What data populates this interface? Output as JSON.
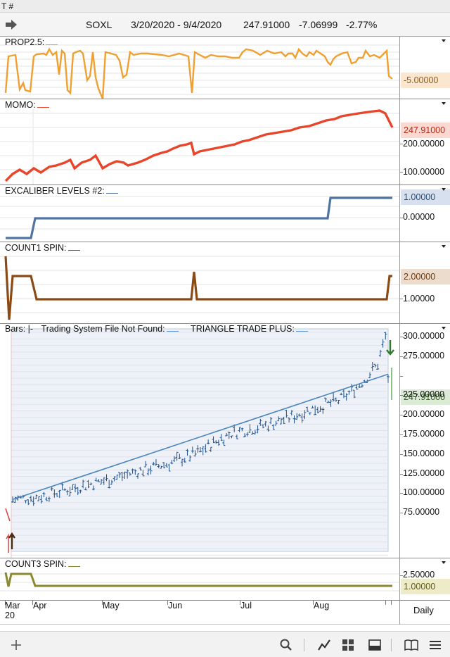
{
  "window": {
    "title_fragment": "T #"
  },
  "header": {
    "symbol": "SOXL",
    "date_range": "3/20/2020 - 9/4/2020",
    "last_price": "247.91000",
    "change": "-7.06999",
    "change_pct": "-2.77%"
  },
  "colors": {
    "prop": "#f0a030",
    "momo": "#e8452a",
    "excaliber": "#4f74a3",
    "count1": "#8b4a14",
    "count3": "#8c8a2e",
    "regression": "#4a86c0",
    "bars": "#1d4f8a"
  },
  "panes": {
    "prop": {
      "title": "PROP2.5:",
      "badge": "-5.00000"
    },
    "momo": {
      "title": "MOMO:",
      "badge": "247.91000",
      "ticks": [
        "200.00000",
        "100.00000"
      ]
    },
    "excaliber": {
      "title": "EXCALIBER LEVELS #2:",
      "badge": "1.00000",
      "ticks": [
        "0.00000"
      ]
    },
    "count1": {
      "title": "COUNT1 SPIN:",
      "badge": "2.00000",
      "ticks": [
        "1.00000"
      ]
    },
    "bars": {
      "title_prefix": "Bars:",
      "title_sep": "|-",
      "system_label": "Trading System File Not Found:",
      "overlay_label": "TRIANGLE TRADE PLUS:",
      "badge": "247.91000",
      "ticks": [
        "300.00000",
        "275.00000",
        "250.00000",
        "225.00000",
        "200.00000",
        "175.00000",
        "150.00000",
        "125.00000",
        "100.00000",
        "75.00000"
      ]
    },
    "count3": {
      "title": "COUNT3 SPIN:",
      "badge": "1.00000",
      "ticks": [
        "2.50000"
      ]
    }
  },
  "date_axis": {
    "months": [
      "Mar",
      "Apr",
      "May",
      "Jun",
      "Jul",
      "Aug"
    ],
    "year": "20",
    "interval": "Daily"
  },
  "toolbar": {
    "icons": [
      "plus-icon",
      "search-icon",
      "line-chart-icon",
      "grid-icon",
      "window-icon",
      "book-icon",
      "hamburger-icon"
    ]
  },
  "chart_data": {
    "type": "line",
    "title": "",
    "ylim": [
      70,
      310
    ],
    "series": [
      {
        "name": "Bars",
        "type": "ohlc-trend",
        "points": [
          [
            0,
            92
          ],
          [
            10,
            95
          ],
          [
            20,
            104
          ],
          [
            30,
            112
          ],
          [
            40,
            120
          ],
          [
            50,
            130
          ],
          [
            60,
            138
          ],
          [
            70,
            150
          ],
          [
            80,
            170
          ],
          [
            85,
            178
          ],
          [
            95,
            185
          ],
          [
            105,
            195
          ],
          [
            115,
            208
          ],
          [
            125,
            218
          ],
          [
            130,
            230
          ],
          [
            135,
            245
          ],
          [
            140,
            265
          ],
          [
            143,
            300
          ],
          [
            144,
            247.91
          ]
        ]
      },
      {
        "name": "Regression",
        "type": "line",
        "points": [
          [
            0,
            92
          ],
          [
            144,
            252
          ]
        ]
      }
    ]
  }
}
